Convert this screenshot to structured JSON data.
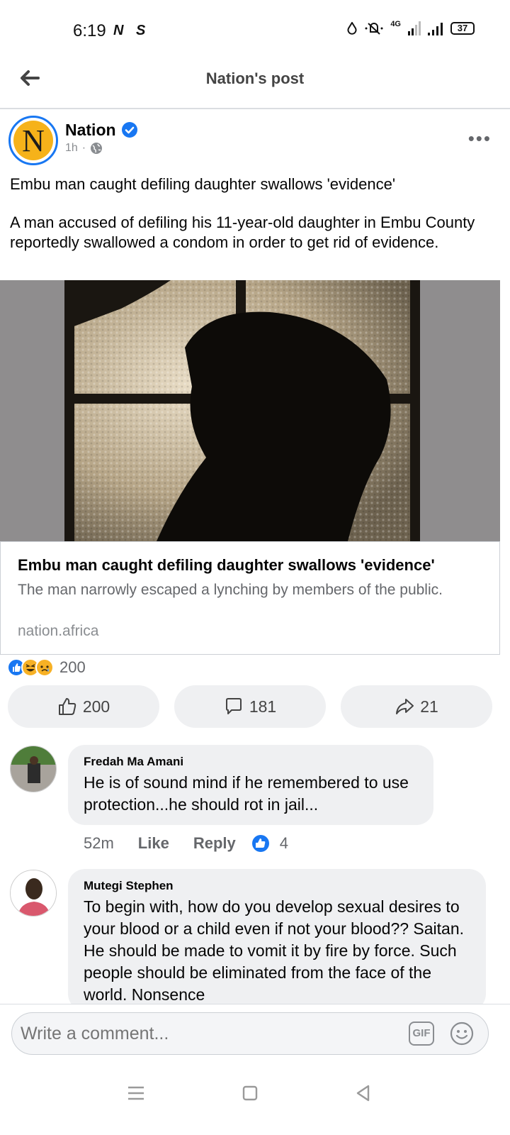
{
  "status_bar": {
    "time": "6:19",
    "app_icons": "N S",
    "network": "4G",
    "battery": "37"
  },
  "header": {
    "title": "Nation's post"
  },
  "post": {
    "avatar_letter": "N",
    "page_name": "Nation",
    "time": "1h",
    "headline": "Embu man caught defiling daughter swallows 'evidence'",
    "body": "A man accused of defiling his 11-year-old daughter in Embu County reportedly swallowed a condom in order to get rid of evidence.",
    "link": {
      "title": "Embu man caught defiling daughter swallows 'evidence'",
      "description": "The man narrowly escaped a lynching by members of the public.",
      "domain": "nation.africa"
    },
    "reaction_total": "200",
    "actions": {
      "like_count": "200",
      "comment_count": "181",
      "share_count": "21"
    }
  },
  "comments": [
    {
      "author": "Fredah Ma Amani",
      "text": "He is of sound mind if he remembered to use protection...he should rot in jail...",
      "time": "52m",
      "like_label": "Like",
      "reply_label": "Reply",
      "likes": "4"
    },
    {
      "author": "Mutegi Stephen",
      "text": "To begin with, how do you develop sexual desires to your blood or a child even if not your blood?? Saitan. He should be made to vomit it by fire by force. Such people should be eliminated  from the face of the world. Nonsence"
    }
  ],
  "composer": {
    "placeholder": "Write a comment...",
    "gif_label": "GIF"
  },
  "colors": {
    "facebook_blue": "#1877f2",
    "bubble_bg": "#eff0f2",
    "secondary_text": "#65676b",
    "nation_yellow": "#f6b21a"
  }
}
